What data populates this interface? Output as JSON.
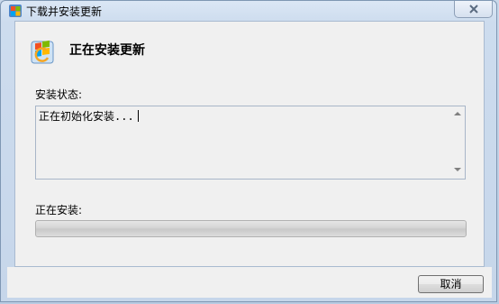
{
  "window": {
    "title": "下载并安装更新",
    "app_icon": "windows-update-icon",
    "close_icon": "close-icon"
  },
  "main": {
    "heading": "正在安装更新",
    "hero_icon": "windows-update-icon",
    "status_label": "安装状态:",
    "status_text": "正在初始化安装...",
    "installing_label": "正在安装:",
    "progress_percent": 0
  },
  "footer": {
    "cancel_label": "取消"
  },
  "colors": {
    "window_frame": "#c6d6ea",
    "content_bg": "#f0f0f0",
    "progress_track": "#d2d2d2"
  }
}
